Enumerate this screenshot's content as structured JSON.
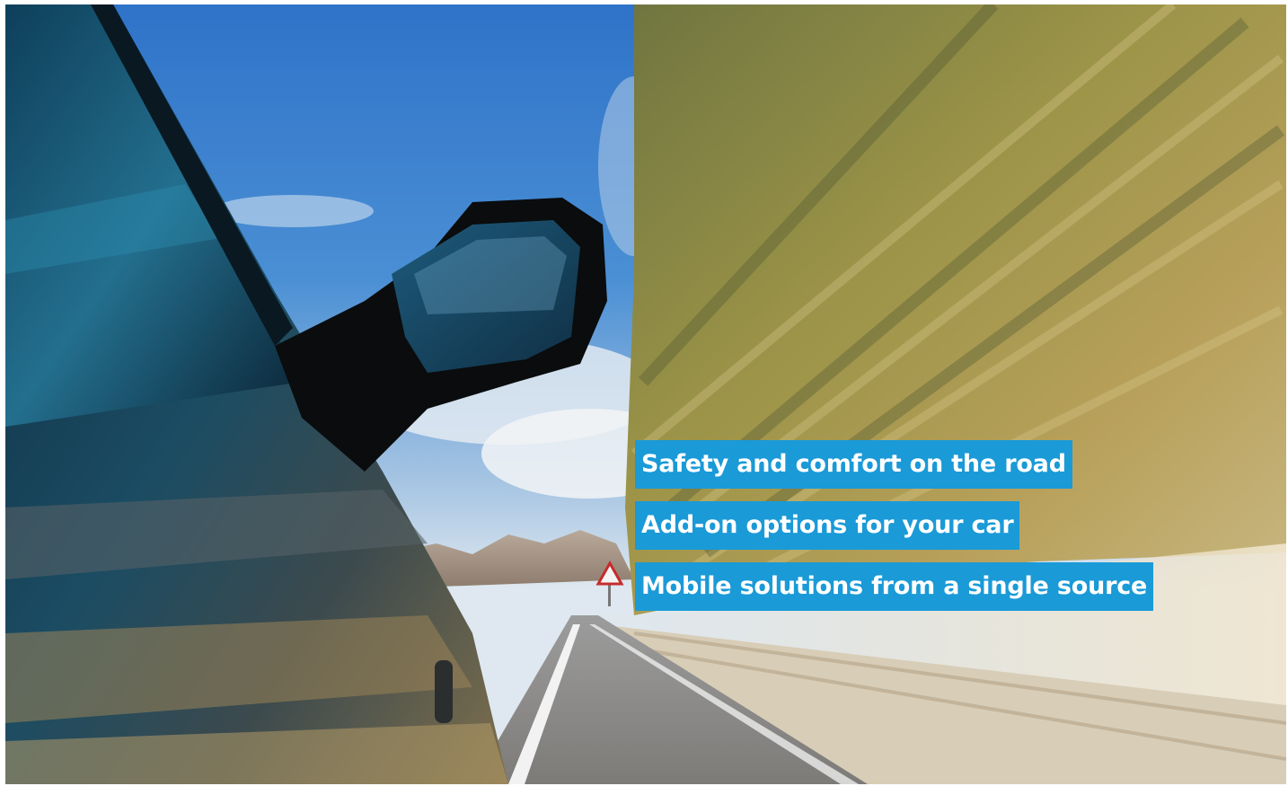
{
  "banner": {
    "taglines": [
      "Safety and comfort on the road",
      "Add-on options for your car",
      "Mobile solutions from a single source"
    ],
    "accent_color": "#1a9ad7"
  }
}
